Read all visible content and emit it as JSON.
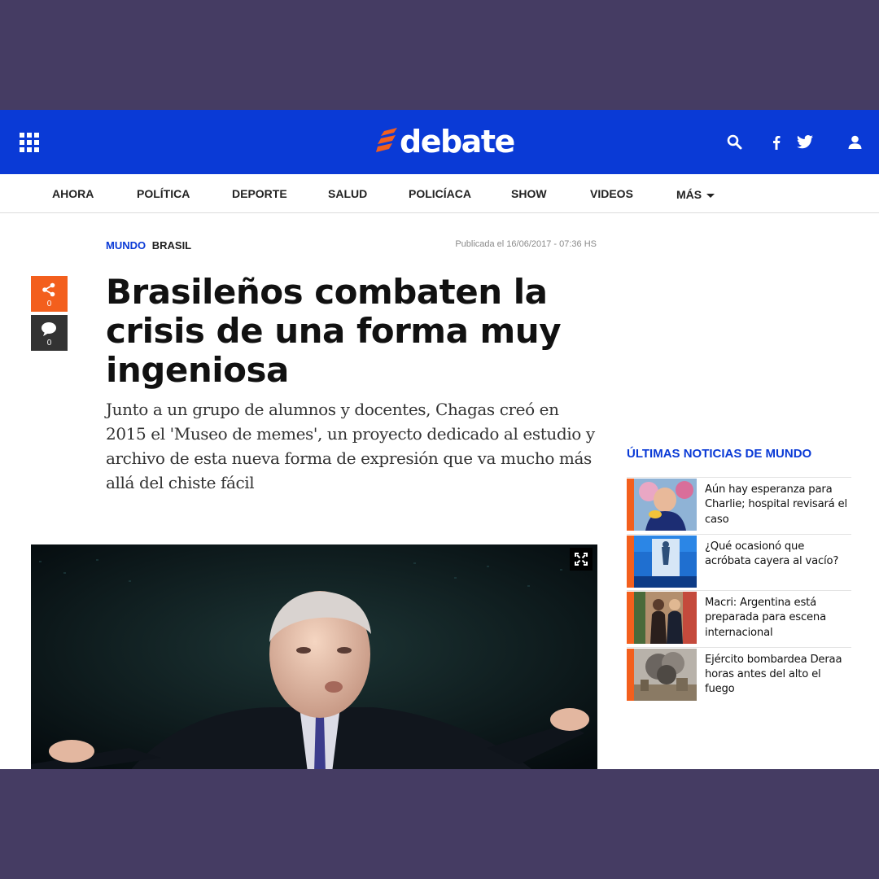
{
  "brand": {
    "name": "debate",
    "accent": "#f35f1d",
    "primary": "#0a3ad6"
  },
  "header": {
    "menu_icon": "grid-menu-icon",
    "icons": [
      "search-icon",
      "facebook-icon",
      "twitter-icon",
      "user-icon"
    ]
  },
  "nav": {
    "items": [
      "AHORA",
      "POLÍTICA",
      "DEPORTE",
      "SALUD",
      "POLICÍACA",
      "SHOW",
      "VIDEOS",
      "MÁS"
    ]
  },
  "article": {
    "section": "MUNDO",
    "subsection": "BRASIL",
    "published": "Publicada el 16/06/2017 - 07:36 HS",
    "title": "Brasileños combaten la crisis de una forma muy ingeniosa",
    "summary": "Junto a un grupo de alumnos y docentes, Chagas creó en 2015 el 'Museo de memes', un proyecto dedicado al estudio y archivo de esta nueva forma de expresión que va mucho más allá del chiste fácil",
    "share_count": "0",
    "comment_count": "0"
  },
  "sidebar": {
    "title": "ÚLTIMAS NOTICIAS DE MUNDO",
    "items": [
      {
        "title": "Aún hay esperanza para Charlie; hospital revisará el caso"
      },
      {
        "title": "¿Qué ocasionó que acróbata cayera al vacío?"
      },
      {
        "title": "Macri: Argentina está preparada para escena internacional"
      },
      {
        "title": "Ejército bombardea Deraa horas antes del alto el fuego"
      }
    ]
  }
}
